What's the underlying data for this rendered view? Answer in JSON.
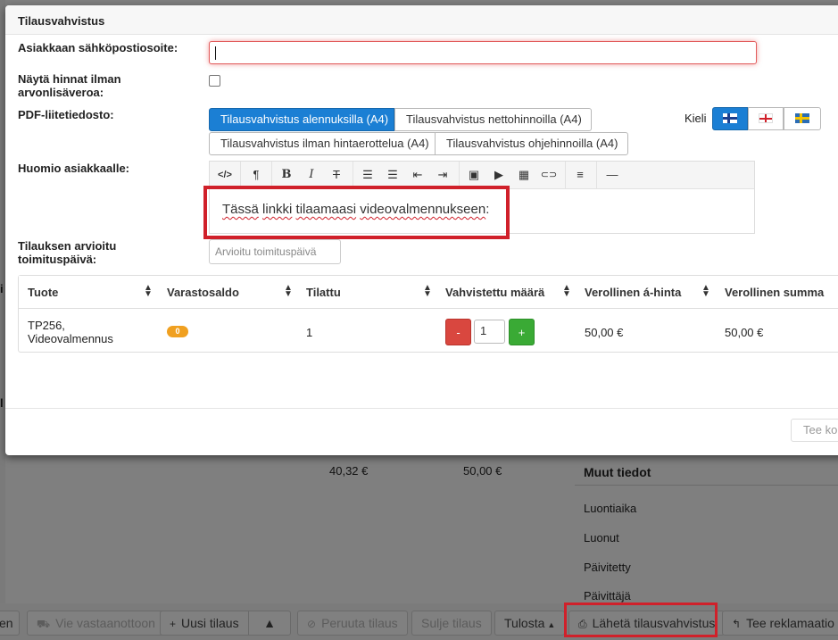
{
  "modal": {
    "title": "Tilausvahvistus",
    "email_label": "Asiakkaan sähköpostiosoite:",
    "email_value": "",
    "vat_label_line1": "Näytä hinnat ilman",
    "vat_label_line2": "arvonlisäveroa:",
    "vat_checked": false,
    "pdf_label": "PDF-liitetiedosto:",
    "pdf_options": [
      "Tilausvahvistus alennuksilla (A4)",
      "Tilausvahvistus nettohinnoilla (A4)",
      "Tilausvahvistus ilman hintaerottelua (A4)",
      "Tilausvahvistus ohjehinnoilla (A4)"
    ],
    "pdf_selected": "Tilausvahvistus alennuksilla (A4)",
    "language_label": "Kieli",
    "languages": [
      "flag-fi-icon",
      "flag-en-icon",
      "flag-sv-icon"
    ],
    "note_label": "Huomio asiakkaalle:",
    "editor_toolbar": {
      "code": "</>",
      "paragraph": "¶",
      "bold": "B",
      "italic": "I",
      "strike": "T",
      "ul": "☰",
      "ol": "☰",
      "outdent": "⇤",
      "indent": "⇥",
      "image": "▣",
      "video": "▶",
      "table": "▦",
      "link": "⊂⊃",
      "align": "≡",
      "hr": "—"
    },
    "note_words": [
      "Tässä",
      "linkki",
      "tilaamaasi",
      "videovalmennukseen"
    ],
    "note_suffix": ":",
    "delivery_label_line1": "Tilauksen arvioitu",
    "delivery_label_line2": "toimituspäivä:",
    "delivery_placeholder": "Arvioitu toimituspäivä",
    "table": {
      "headers": [
        "Tuote",
        "Varastosaldo",
        "Tilattu",
        "Vahvistettu määrä",
        "Verollinen á-hinta",
        "Verollinen summa"
      ],
      "row": {
        "product_line1": "TP256,",
        "product_line2": "Videovalmennus",
        "stock": "0",
        "ordered": "1",
        "minus": "-",
        "confirmed_qty": "1",
        "plus": "+",
        "unit_price": "50,00 €",
        "total": "50,00 €"
      }
    },
    "footer_button": "Tee ko"
  },
  "background": {
    "stray_letters": [
      "i",
      "l"
    ],
    "amounts": [
      "40,32 €",
      "50,00 €"
    ],
    "section_title": "Muut tiedot",
    "info_items": [
      "Luontiaika",
      "Luonut",
      "Päivitetty",
      "Päivittäjä"
    ]
  },
  "toolbar": {
    "partial_left": "en",
    "receive": "Vie vastaanottoon",
    "new_order": "Uusi tilaus",
    "cancel_order": "Peruuta tilaus",
    "close_order": "Sulje tilaus",
    "print": "Tulosta",
    "send_confirmation": "Lähetä tilausvahvistus",
    "complaint": "Tee reklamaatio"
  },
  "colors": {
    "primary": "#1b7fd4",
    "danger": "#d9473f",
    "success": "#3aaa35",
    "warning_badge": "#f0a020",
    "annotation": "#d0202a"
  }
}
